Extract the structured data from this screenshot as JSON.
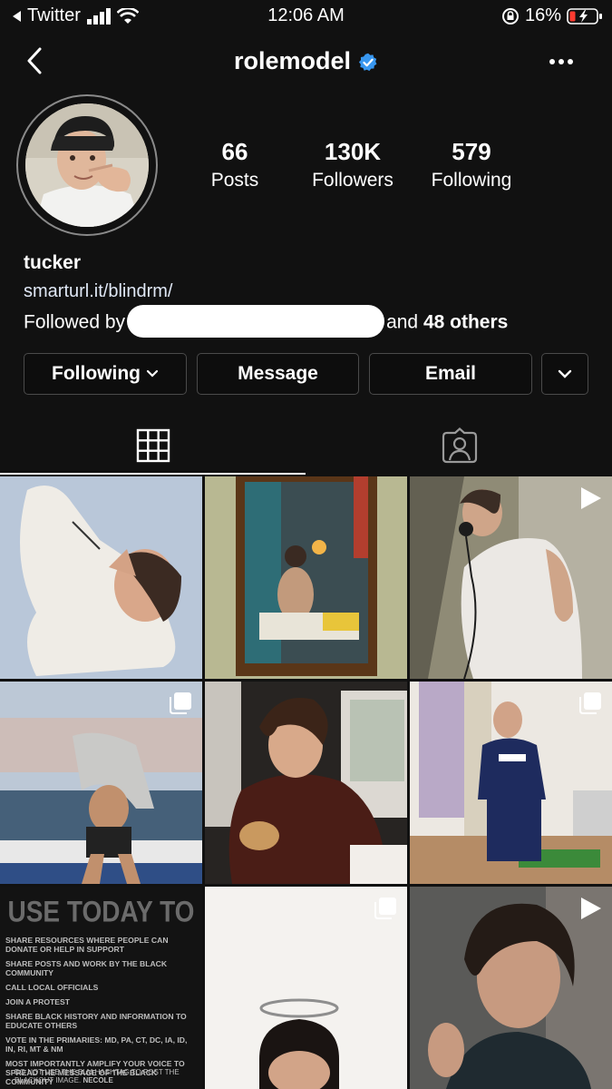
{
  "status_bar": {
    "carrier": "Twitter",
    "time": "12:06 AM",
    "battery": "16%",
    "icons": [
      "back-arrow-small-icon",
      "signal-bars-icon",
      "wifi-icon",
      "orientation-lock-icon",
      "battery-charging-icon"
    ]
  },
  "header": {
    "username": "rolemodel",
    "verified": true,
    "icons": [
      "back-chevron-icon",
      "verified-badge-icon",
      "more-options-icon"
    ]
  },
  "profile": {
    "stats": [
      {
        "value": "66",
        "label": "Posts"
      },
      {
        "value": "130K",
        "label": "Followers"
      },
      {
        "value": "579",
        "label": "Following"
      }
    ],
    "name": "tucker",
    "link": "smarturl.it/blindrm/",
    "followed_by_prefix": "Followed by",
    "followed_by_and": "and",
    "followed_by_others": "48 others"
  },
  "actions": {
    "following": "Following",
    "message": "Message",
    "email": "Email"
  },
  "tabs": {
    "grid_icon": "grid-icon",
    "tagged_icon": "tagged-person-icon",
    "active": "grid"
  },
  "posts": [
    {
      "type": "photo"
    },
    {
      "type": "photo"
    },
    {
      "type": "video"
    },
    {
      "type": "carousel"
    },
    {
      "type": "photo"
    },
    {
      "type": "carousel"
    },
    {
      "type": "photo"
    },
    {
      "type": "carousel"
    },
    {
      "type": "video"
    }
  ],
  "poster": {
    "headline": "USE TODAY TO",
    "items": [
      "SHARE RESOURCES WHERE PEOPLE CAN DONATE OR HELP IN SUPPORT",
      "SHARE POSTS AND WORK BY THE BLACK COMMUNITY",
      "CALL LOCAL OFFICIALS",
      "JOIN A PROTEST",
      "SHARE BLACK HISTORY AND INFORMATION TO EDUCATE OTHERS",
      "VOTE IN THE PRIMARIES: MD, PA, CT, DC, IA, ID, IN, RI, MT & NM",
      "MOST IMPORTANTLY AMPLIFY YOUR VOICE TO SPREAD THE MESSAGE OF THE BLACK COMMUNITY"
    ],
    "footer": "DO NOT USE THE BLM HASHTAG TO POST THE BLACKOUT IMAGE.",
    "signature": "NECOLE"
  },
  "colors": {
    "background": "#111111",
    "verified": "#3897f0",
    "battery_low": "#ff3b30",
    "button_border": "#4a4a4a"
  }
}
